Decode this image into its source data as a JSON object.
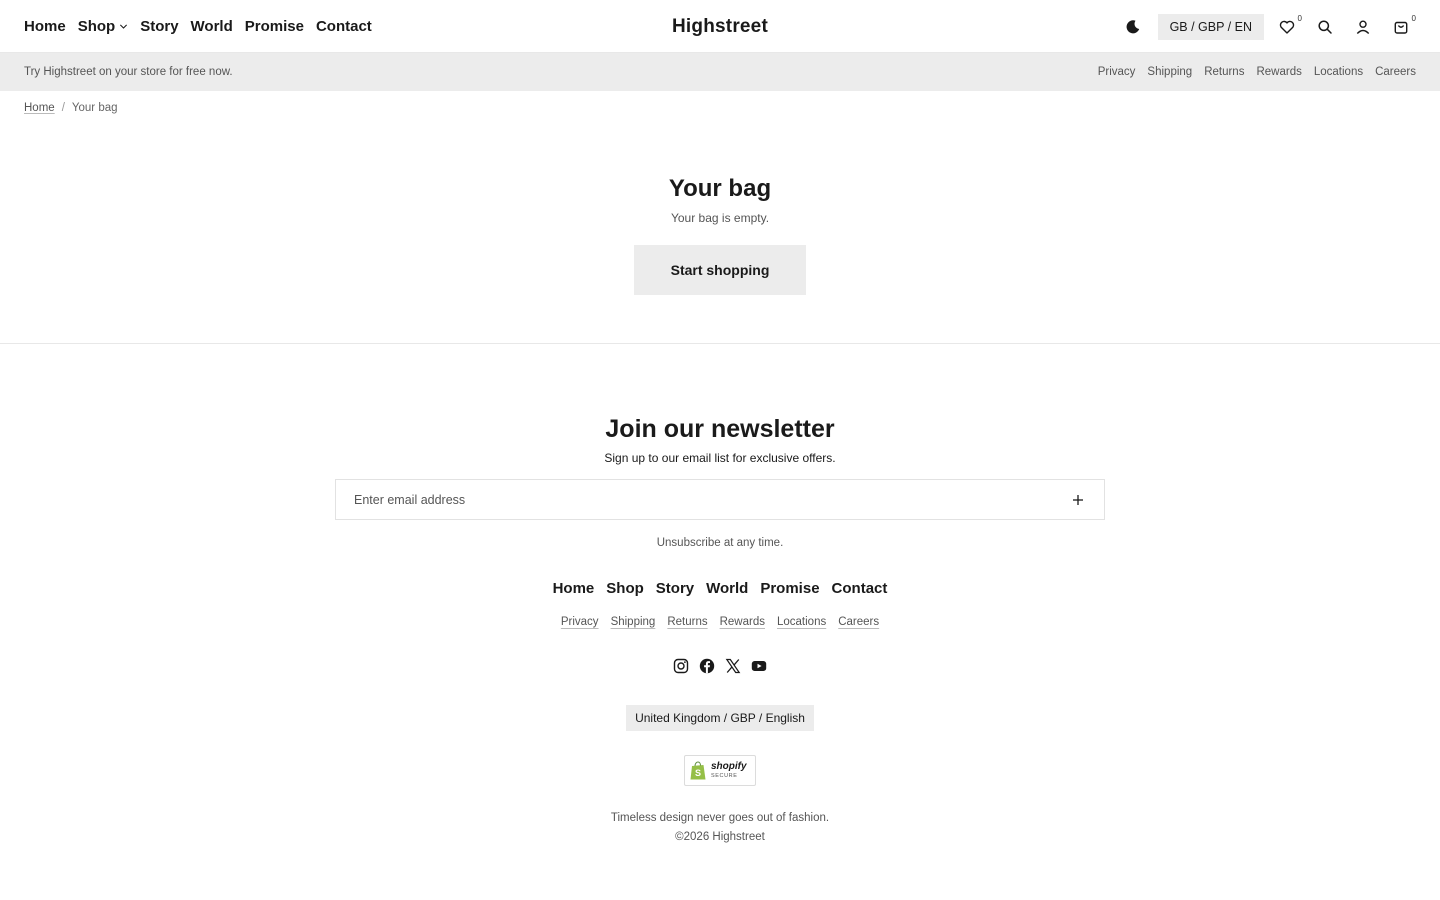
{
  "header": {
    "nav": [
      "Home",
      "Shop",
      "Story",
      "World",
      "Promise",
      "Contact"
    ],
    "brand": "Highstreet",
    "locale": "GB / GBP / EN",
    "wishlist_count": "0",
    "cart_count": "0"
  },
  "announcement": {
    "text": "Try Highstreet on your store for free now.",
    "links": [
      "Privacy",
      "Shipping",
      "Returns",
      "Rewards",
      "Locations",
      "Careers"
    ]
  },
  "breadcrumb": {
    "home": "Home",
    "separator": "/",
    "current": "Your bag"
  },
  "cart": {
    "title": "Your bag",
    "empty_message": "Your bag is empty.",
    "cta": "Start shopping"
  },
  "newsletter": {
    "title": "Join our newsletter",
    "subtitle": "Sign up to our email list for exclusive offers.",
    "placeholder": "Enter email address",
    "note": "Unsubscribe at any time."
  },
  "footer": {
    "nav": [
      "Home",
      "Shop",
      "Story",
      "World",
      "Promise",
      "Contact"
    ],
    "links": [
      "Privacy",
      "Shipping",
      "Returns",
      "Rewards",
      "Locations",
      "Careers"
    ],
    "social_icons": [
      "instagram-icon",
      "facebook-icon",
      "x-icon",
      "youtube-icon"
    ],
    "locale": "United Kingdom / GBP / English",
    "badge_word": "shopify",
    "badge_secure": "SECURE",
    "tagline": "Timeless design never goes out of fashion.",
    "copyright": "©2026 Highstreet"
  },
  "colors": {
    "text": "#1a1a1a",
    "muted": "#555555",
    "surface": "#ececec",
    "border": "#e8e8e8",
    "shopify_green": "#95bf47"
  }
}
